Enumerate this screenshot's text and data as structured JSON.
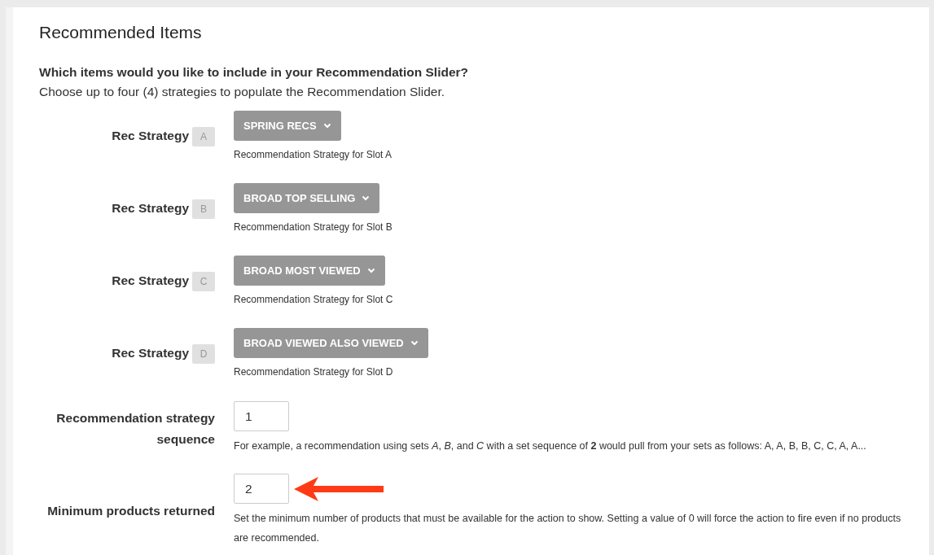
{
  "title": "Recommended Items",
  "question": "Which items would you like to include in your Recommendation Slider?",
  "instructions": "Choose up to four (4) strategies to populate the Recommendation Slider.",
  "strategies": [
    {
      "label": "Rec Strategy",
      "slot": "A",
      "value": "SPRING RECS",
      "hint": "Recommendation Strategy for Slot A"
    },
    {
      "label": "Rec Strategy",
      "slot": "B",
      "value": "BROAD TOP SELLING",
      "hint": "Recommendation Strategy for Slot B"
    },
    {
      "label": "Rec Strategy",
      "slot": "C",
      "value": "BROAD MOST VIEWED",
      "hint": "Recommendation Strategy for Slot C"
    },
    {
      "label": "Rec Strategy",
      "slot": "D",
      "value": "BROAD VIEWED ALSO VIEWED",
      "hint": "Recommendation Strategy for Slot D"
    }
  ],
  "fields": [
    {
      "label": "Recommendation strategy sequence",
      "value": "1",
      "hint": "For example, a recommendation using sets *A*, *B*, and *C* with a set sequence of **2** would pull from your sets as follows: A, A, B, B, C, C, A, A...",
      "arrow": false
    },
    {
      "label": "Minimum products returned",
      "value": "2",
      "hint": "Set the minimum number of products that must be available for the action to show. Setting a value of 0 will force the action to fire even if no products are recommended.",
      "arrow": true
    }
  ]
}
